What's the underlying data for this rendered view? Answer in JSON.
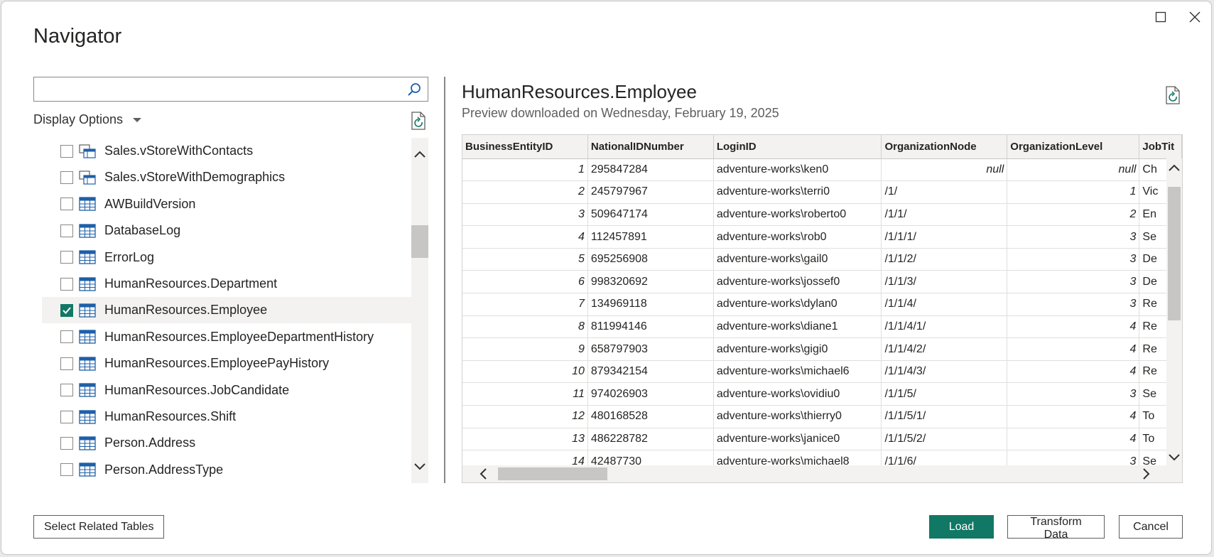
{
  "window": {
    "title": "Navigator"
  },
  "search": {
    "value": "",
    "placeholder": ""
  },
  "display_options": {
    "label": "Display Options"
  },
  "nav_items": [
    {
      "label": "Sales.vStoreWithContacts",
      "icon": "view-icon",
      "checked": false,
      "selected": false
    },
    {
      "label": "Sales.vStoreWithDemographics",
      "icon": "view-icon",
      "checked": false,
      "selected": false
    },
    {
      "label": "AWBuildVersion",
      "icon": "table-icon",
      "checked": false,
      "selected": false
    },
    {
      "label": "DatabaseLog",
      "icon": "table-icon",
      "checked": false,
      "selected": false
    },
    {
      "label": "ErrorLog",
      "icon": "table-icon",
      "checked": false,
      "selected": false
    },
    {
      "label": "HumanResources.Department",
      "icon": "table-icon",
      "checked": false,
      "selected": false
    },
    {
      "label": "HumanResources.Employee",
      "icon": "table-icon",
      "checked": true,
      "selected": true
    },
    {
      "label": "HumanResources.EmployeeDepartmentHistory",
      "icon": "table-icon",
      "checked": false,
      "selected": false
    },
    {
      "label": "HumanResources.EmployeePayHistory",
      "icon": "table-icon",
      "checked": false,
      "selected": false
    },
    {
      "label": "HumanResources.JobCandidate",
      "icon": "table-icon",
      "checked": false,
      "selected": false
    },
    {
      "label": "HumanResources.Shift",
      "icon": "table-icon",
      "checked": false,
      "selected": false
    },
    {
      "label": "Person.Address",
      "icon": "table-icon",
      "checked": false,
      "selected": false
    },
    {
      "label": "Person.AddressType",
      "icon": "table-icon",
      "checked": false,
      "selected": false
    }
  ],
  "preview": {
    "title": "HumanResources.Employee",
    "subtitle": "Preview downloaded on Wednesday, February 19, 2025",
    "columns": [
      "BusinessEntityID",
      "NationalIDNumber",
      "LoginID",
      "OrganizationNode",
      "OrganizationLevel",
      "JobTit"
    ],
    "rows": [
      [
        "1",
        "295847284",
        "adventure-works\\ken0",
        "null",
        "null",
        "Ch"
      ],
      [
        "2",
        "245797967",
        "adventure-works\\terri0",
        "/1/",
        "1",
        "Vic"
      ],
      [
        "3",
        "509647174",
        "adventure-works\\roberto0",
        "/1/1/",
        "2",
        "En"
      ],
      [
        "4",
        "112457891",
        "adventure-works\\rob0",
        "/1/1/1/",
        "3",
        "Se"
      ],
      [
        "5",
        "695256908",
        "adventure-works\\gail0",
        "/1/1/2/",
        "3",
        "De"
      ],
      [
        "6",
        "998320692",
        "adventure-works\\jossef0",
        "/1/1/3/",
        "3",
        "De"
      ],
      [
        "7",
        "134969118",
        "adventure-works\\dylan0",
        "/1/1/4/",
        "3",
        "Re"
      ],
      [
        "8",
        "811994146",
        "adventure-works\\diane1",
        "/1/1/4/1/",
        "4",
        "Re"
      ],
      [
        "9",
        "658797903",
        "adventure-works\\gigi0",
        "/1/1/4/2/",
        "4",
        "Re"
      ],
      [
        "10",
        "879342154",
        "adventure-works\\michael6",
        "/1/1/4/3/",
        "4",
        "Re"
      ],
      [
        "11",
        "974026903",
        "adventure-works\\ovidiu0",
        "/1/1/5/",
        "3",
        "Se"
      ],
      [
        "12",
        "480168528",
        "adventure-works\\thierry0",
        "/1/1/5/1/",
        "4",
        "To"
      ],
      [
        "13",
        "486228782",
        "adventure-works\\janice0",
        "/1/1/5/2/",
        "4",
        "To"
      ],
      [
        "14",
        "42487730",
        "adventure-works\\michael8",
        "/1/1/6/",
        "3",
        "Se"
      ]
    ]
  },
  "footer": {
    "select_related": "Select Related Tables",
    "load": "Load",
    "transform": "Transform Data",
    "cancel": "Cancel"
  },
  "colors": {
    "accent": "#117865"
  }
}
